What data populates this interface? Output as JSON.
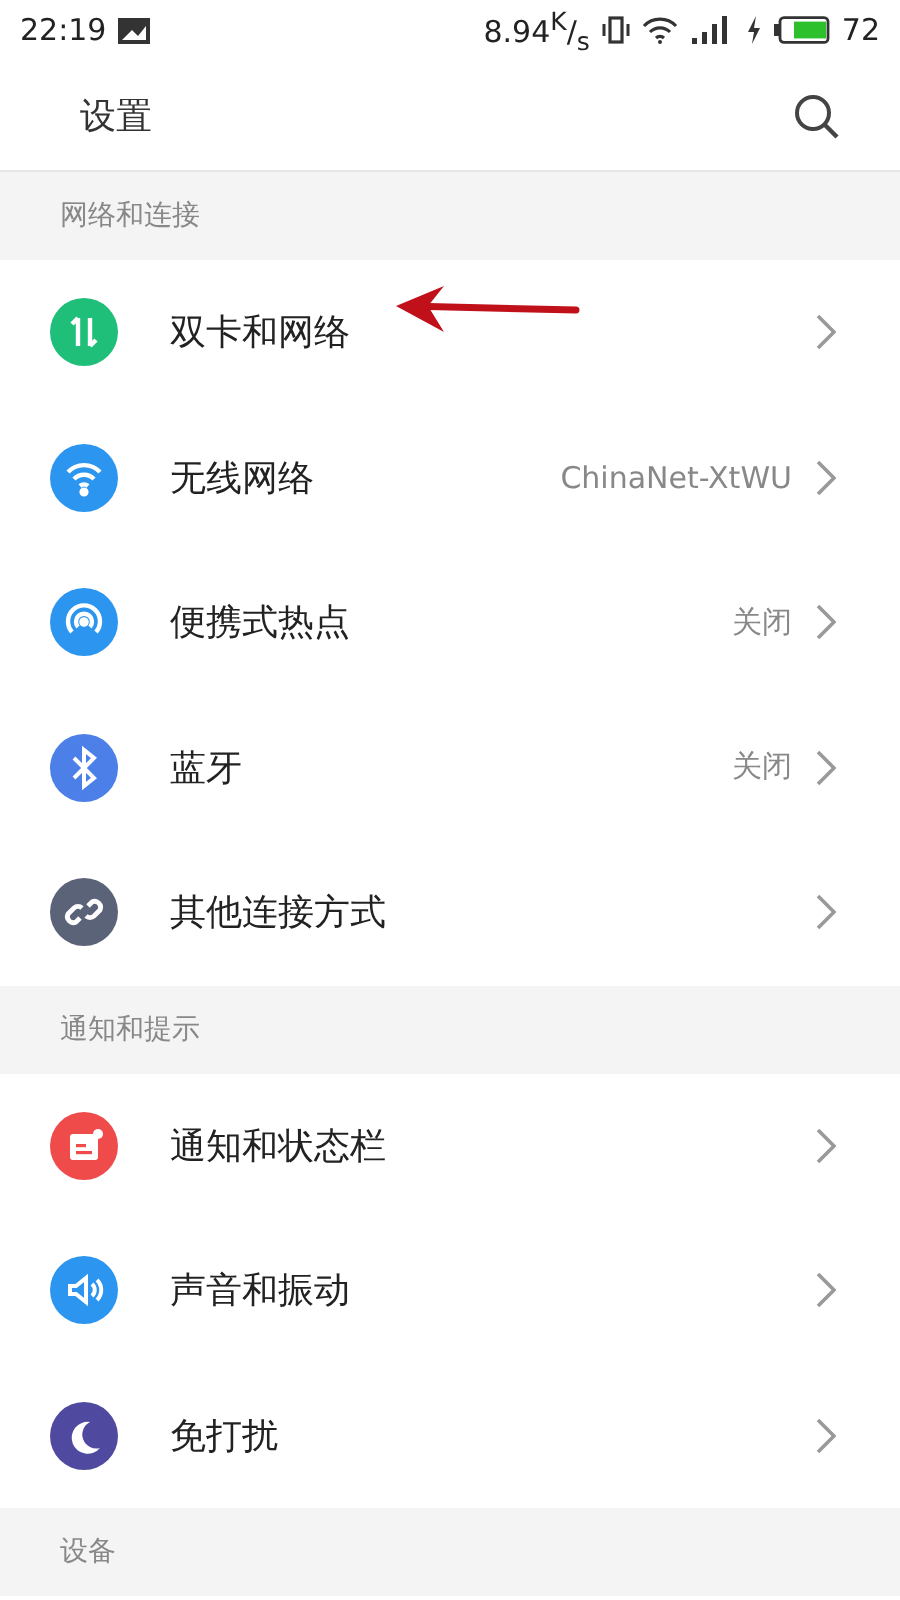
{
  "status_bar": {
    "time": "22:19",
    "speed": "8.94$^{K}$/$_{s}$",
    "battery": "72"
  },
  "header": {
    "title": "设置"
  },
  "sections": [
    {
      "title": "网络和连接",
      "items": [
        {
          "label": "双卡和网络",
          "kind": "sim",
          "color": "#1fbf7a",
          "annotated": true
        },
        {
          "label": "无线网络",
          "value": "ChinaNet-XtWU",
          "kind": "wifi",
          "color": "#2b95f0",
          "annotated": false
        },
        {
          "label": "便携式热点",
          "value": "关闭",
          "kind": "hotspot",
          "color": "#2b95f0",
          "annotated": false
        },
        {
          "label": "蓝牙",
          "value": "关闭",
          "kind": "bluetooth",
          "color": "#4c7fe8",
          "annotated": false
        },
        {
          "label": "其他连接方式",
          "kind": "link",
          "color": "#5a6377",
          "annotated": false
        }
      ]
    },
    {
      "title": "通知和提示",
      "items": [
        {
          "label": "通知和状态栏",
          "kind": "notice",
          "color": "#ef4b4b",
          "annotated": false
        },
        {
          "label": "声音和振动",
          "kind": "sound",
          "color": "#2b95f0",
          "annotated": false
        },
        {
          "label": "免打扰",
          "kind": "moon",
          "color": "#4f4aa0",
          "annotated": false
        }
      ]
    },
    {
      "title": "设备"
    }
  ]
}
